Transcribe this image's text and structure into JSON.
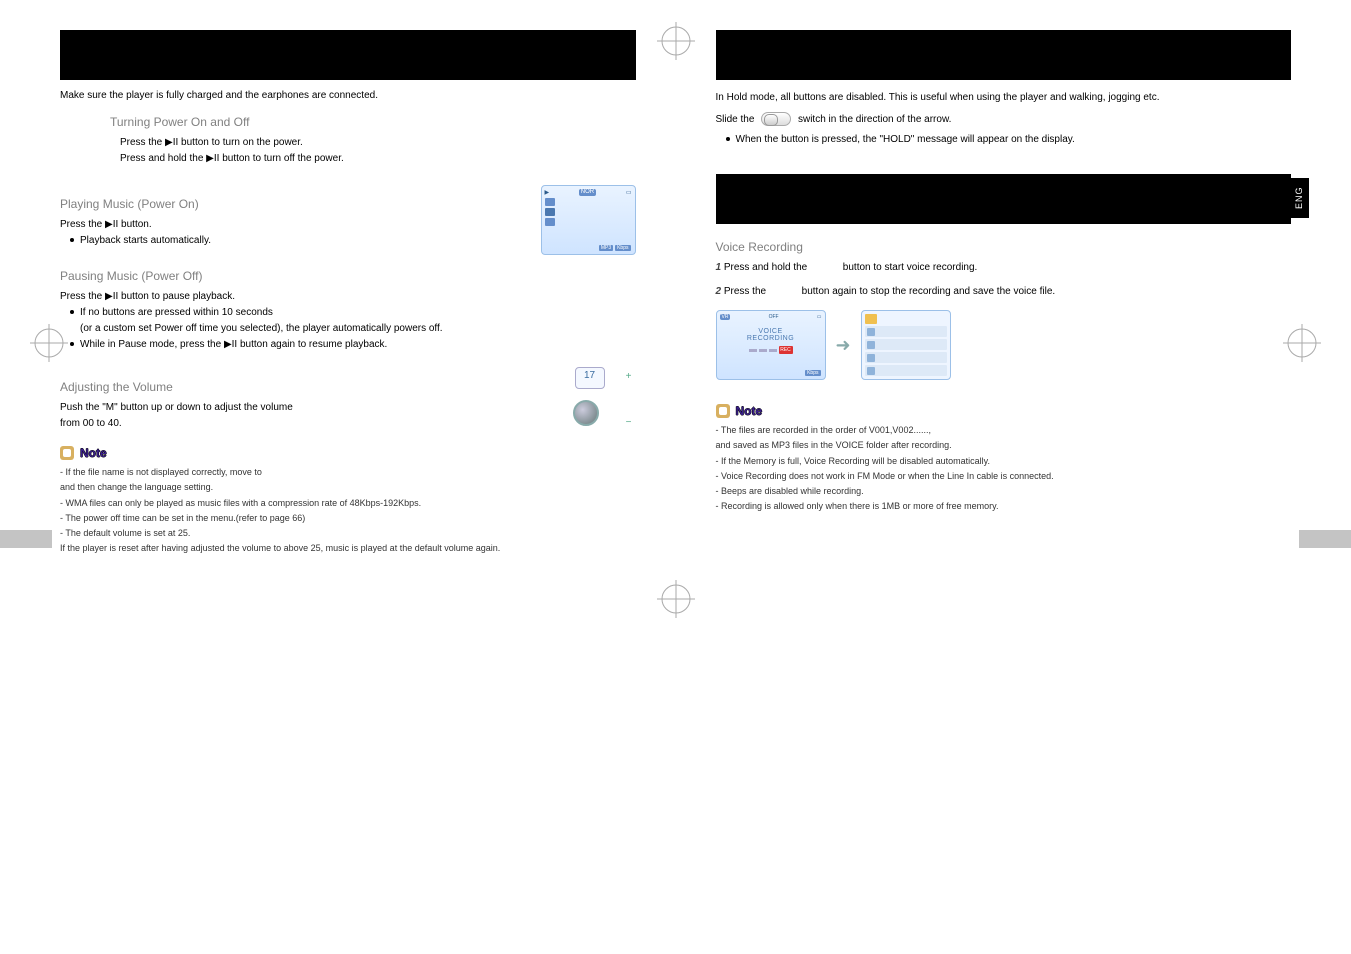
{
  "left": {
    "intro": "Make sure the player is fully charged and the earphones are connected.",
    "h_power": "Turning Power On and Off",
    "power_on": "Press the  ▶II button to turn on the power.",
    "power_off": "Press and hold the  ▶II button to turn off the power.",
    "h_play": "Playing Music (Power On)",
    "play_press": "Press the ▶II button.",
    "play_bullet": "Playback starts automatically.",
    "h_pause": "Pausing Music (Power Off)",
    "pause_press": "Press the ▶II button to pause playback.",
    "pause_b1": "If no buttons are pressed within 10 seconds",
    "pause_b1b": "(or a custom set Power off time you selected), the player automatically powers off.",
    "pause_b2": "While in Pause mode, press the ▶II button again to resume playback.",
    "h_vol": "Adjusting the Volume",
    "vol_text1": "Push the \"M\" button up or down to adjust the volume",
    "vol_text2": "from 00 to 40.",
    "vol_num": "17",
    "note_label": "Note",
    "n1": "- If the file name is not displayed correctly, move to",
    "n1b": "  and then change the language setting.",
    "n2": "- WMA files can only be played as music files with a compression rate of 48Kbps-192Kbps.",
    "n3": "- The power off time can be set in the menu.(refer to page 66)",
    "n4": "- The default volume is set at 25.",
    "n4b": "  If the player is reset after having adjusted the volume to above 25, music is played at the default volume again.",
    "screen": {
      "nor": "NOR",
      "mp3": "MP3",
      "kbps": "Kbps"
    }
  },
  "right": {
    "eng": "ENG",
    "hold_intro": "In Hold mode, all buttons are disabled. This is useful when using the player and walking, jogging etc.",
    "hold_slide": "Slide the             switch in the direction of the arrow.",
    "hold_bullet": "When the button is pressed, the \"HOLD\" message will appear on the display.",
    "h_rec": "Voice Recording",
    "rec1a": "Press and hold the",
    "rec1b": "button to start voice recording.",
    "rec2a": "Press the",
    "rec2b": "button again to stop the recording and save the voice file.",
    "screen": {
      "vr": "VR",
      "off": "OFF",
      "title1": "VOICE",
      "title2": "RECORDING",
      "rec": "REC",
      "kbps": "Kbps"
    },
    "note_label": "Note",
    "n1": "- The files are recorded in the order of V001,V002......,",
    "n1b": "  and saved as MP3 files in the VOICE folder after recording.",
    "n2": "- If the Memory is full, Voice Recording will be disabled automatically.",
    "n3": "- Voice Recording does not work in FM Mode or when the Line In cable is connected.",
    "n4": "- Beeps are disabled while recording.",
    "n5": "- Recording is allowed only when there is 1MB or more of free memory."
  }
}
